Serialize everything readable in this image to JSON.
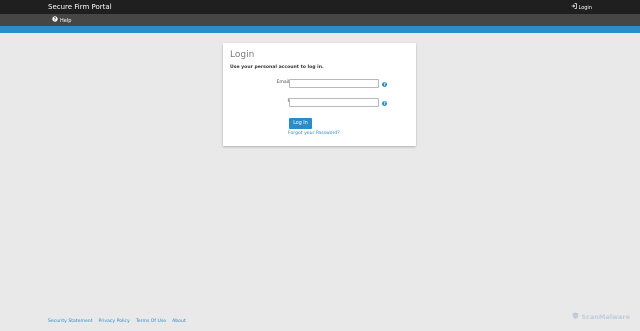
{
  "header": {
    "brand": "Secure Firm Portal",
    "login_label": "Login",
    "help_label": "Help"
  },
  "login_card": {
    "title": "Login",
    "subtitle": "Use your personal account to log in.",
    "email_label": "Email Address",
    "password_label": "Password",
    "email_value": "",
    "password_value": "",
    "submit_label": "Log In",
    "forgot_label": "Forgot your Password?"
  },
  "footer": {
    "links": [
      "Security Statement",
      "Privacy Policy",
      "Terms Of Use",
      "About"
    ]
  },
  "watermark": {
    "text": "ScanMalware"
  },
  "colors": {
    "topbar": "#1f1f1f",
    "subbar": "#464646",
    "accent": "#2b8cc8",
    "background": "#e9e9e9"
  },
  "icons": {
    "login": "sign-in-icon",
    "help": "help-circle-icon",
    "info": "info-circle-icon"
  }
}
